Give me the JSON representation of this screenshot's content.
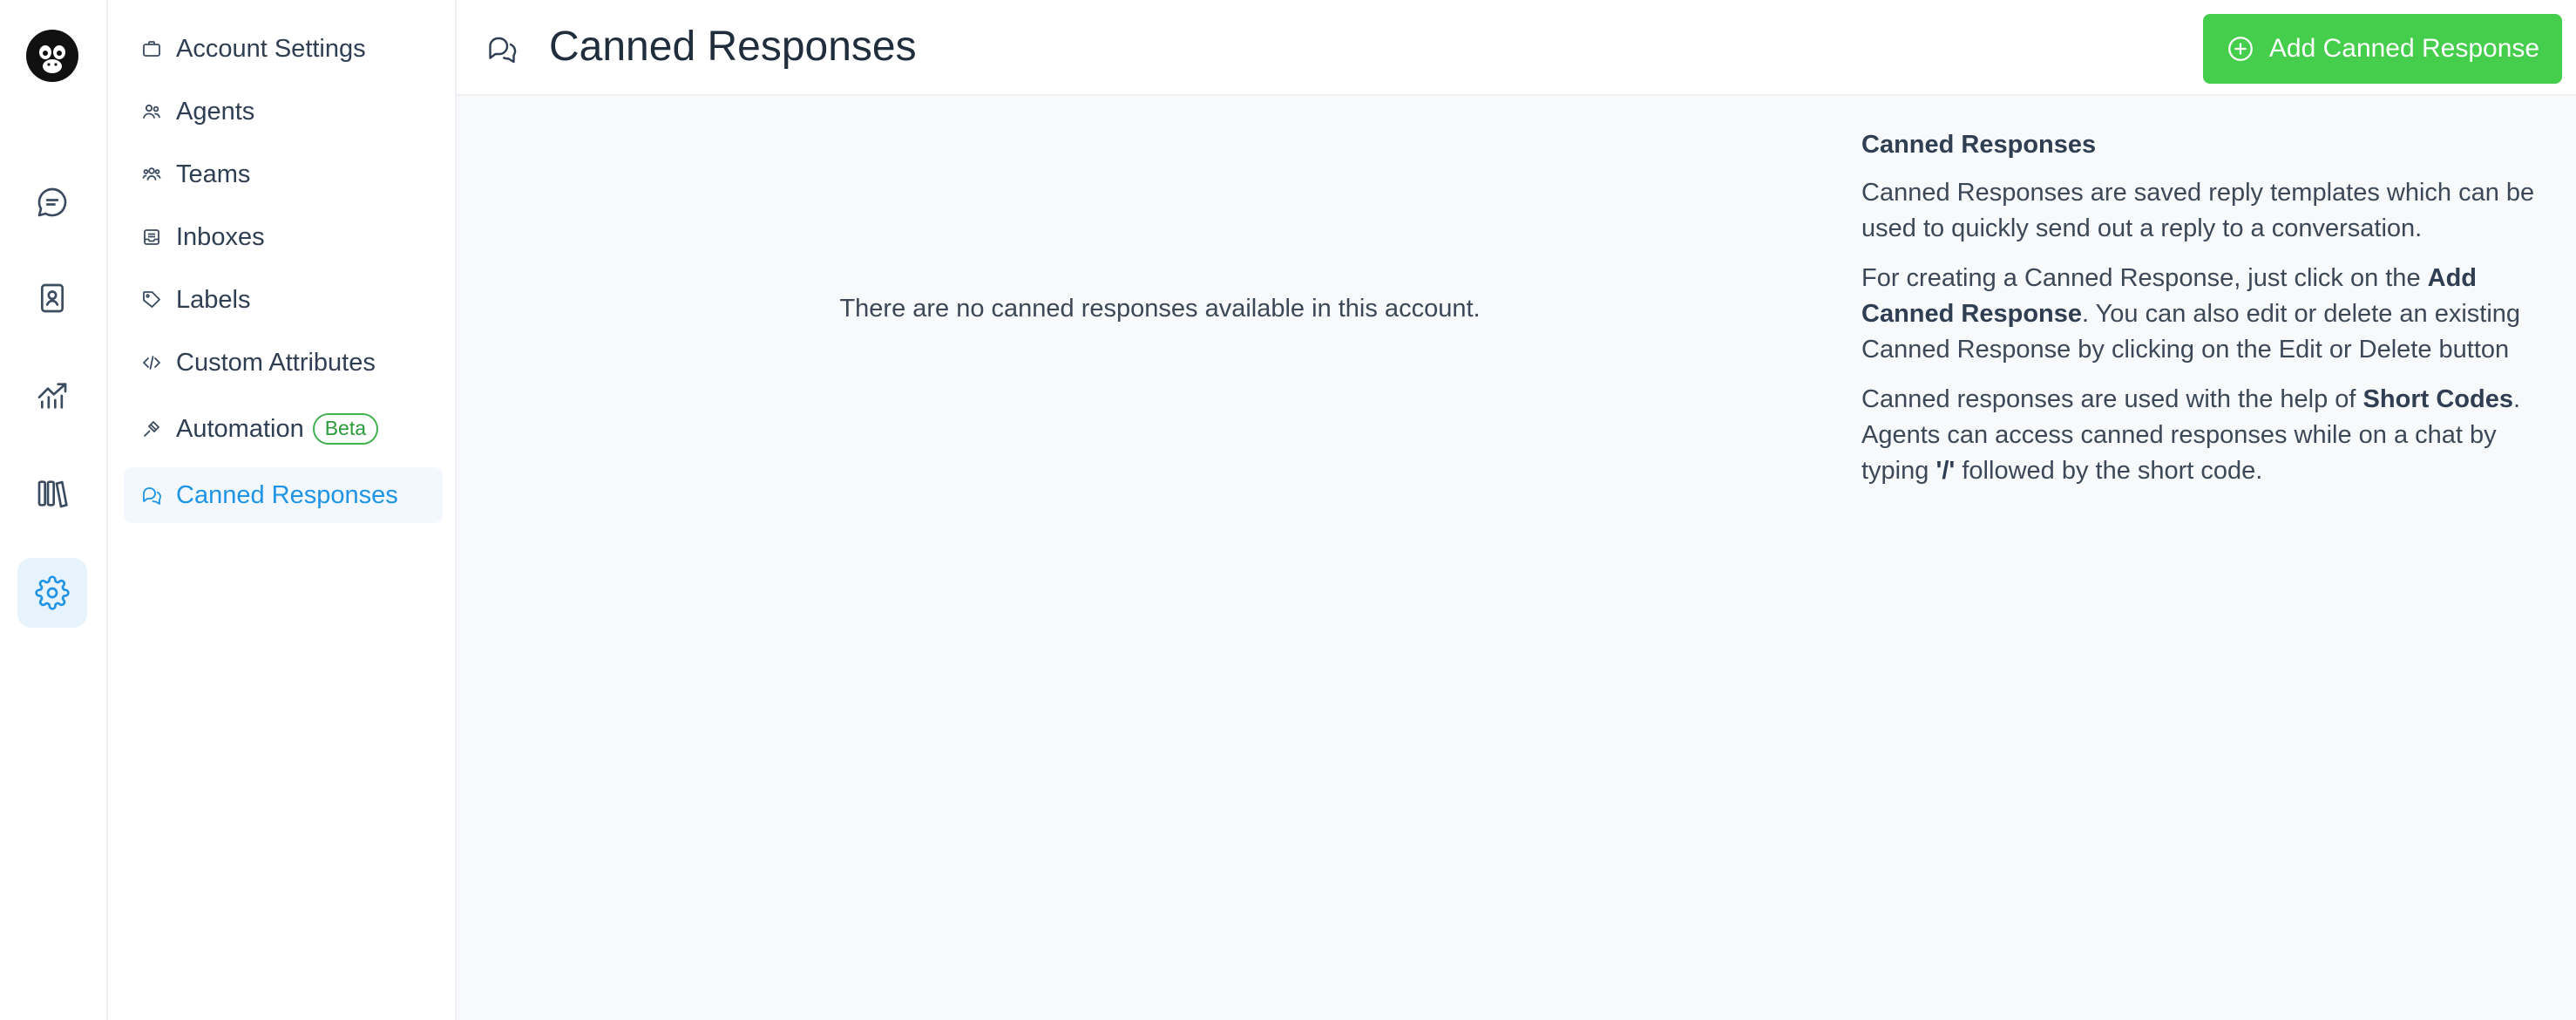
{
  "sidebar": {
    "items": [
      {
        "label": "Account Settings",
        "icon": "briefcase-icon"
      },
      {
        "label": "Agents",
        "icon": "people-icon"
      },
      {
        "label": "Teams",
        "icon": "team-icon"
      },
      {
        "label": "Inboxes",
        "icon": "inbox-icon"
      },
      {
        "label": "Labels",
        "icon": "tag-icon"
      },
      {
        "label": "Custom Attributes",
        "icon": "code-icon"
      },
      {
        "label": "Automation",
        "icon": "automation-icon",
        "badge": "Beta"
      },
      {
        "label": "Canned Responses",
        "icon": "chat-bubbles-icon",
        "active": true
      }
    ]
  },
  "rail": {
    "items": [
      "conversations-icon",
      "contacts-icon",
      "reports-icon",
      "library-icon",
      "settings-icon"
    ],
    "active": "settings-icon"
  },
  "header": {
    "title": "Canned Responses",
    "add_button": "Add Canned Response"
  },
  "main": {
    "empty_text": "There are no canned responses available in this account."
  },
  "help": {
    "title": "Canned Responses",
    "p1": "Canned Responses are saved reply templates which can be used to quickly send out a reply to a conversation.",
    "p2_a": "For creating a Canned Response, just click on the ",
    "p2_b": "Add Canned Response",
    "p2_c": ". You can also edit or delete an existing Canned Response by clicking on the Edit or Delete button",
    "p3_a": "Canned responses are used with the help of ",
    "p3_b": "Short Codes",
    "p3_c": ". Agents can access canned responses while on a chat by typing ",
    "p3_d": "'/'",
    "p3_e": " followed by the short code."
  },
  "colors": {
    "accent": "#1f93e6",
    "add_button": "#44ce4b",
    "beta": "#2a9a3a"
  }
}
